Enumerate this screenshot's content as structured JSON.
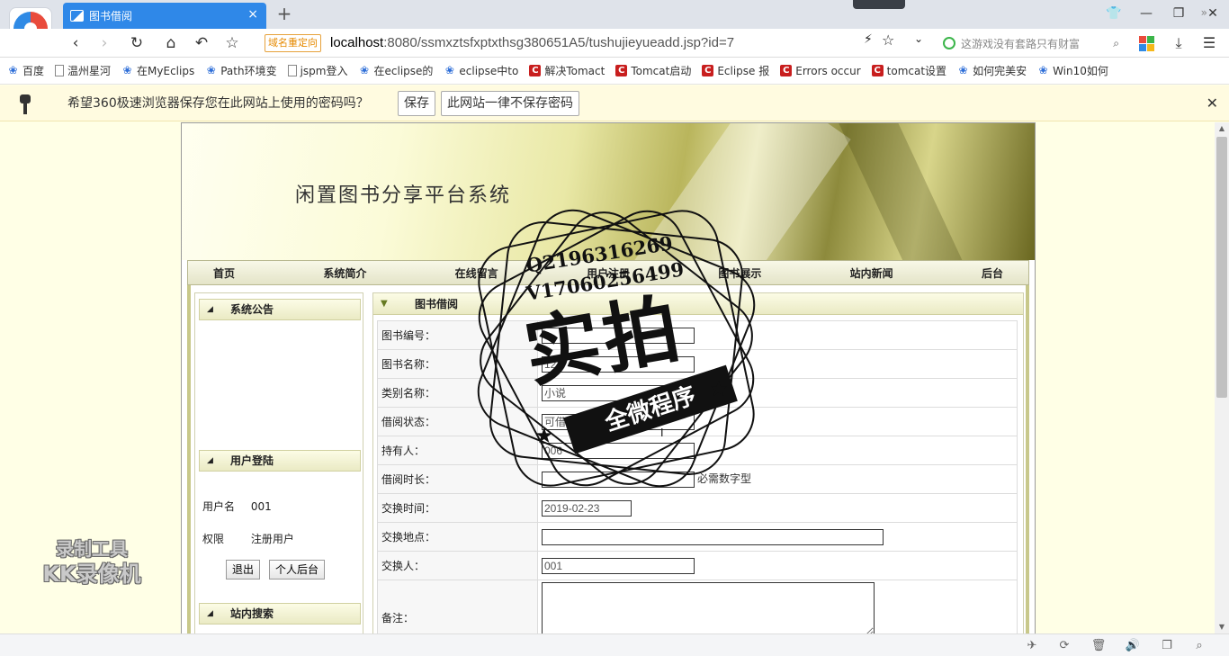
{
  "browser": {
    "tab_title": "图书借阅",
    "tab_close": "×",
    "new_tab": "+",
    "redirect_badge": "域名重定向",
    "url_host": "localhost",
    "url_rest": ":8080/ssmxztsfxptxthsg380651A5/tushujieyueadd.jsp?id=7",
    "search_placeholder": "这游戏没有套路只有财富",
    "bookmarks": [
      {
        "label": "百度",
        "icon": "paw-icon"
      },
      {
        "label": "温州星河",
        "icon": "doc-icon"
      },
      {
        "label": "在MyEclips",
        "icon": "paw-icon"
      },
      {
        "label": "Path环境变",
        "icon": "paw-icon"
      },
      {
        "label": "jspm登入",
        "icon": "doc-icon"
      },
      {
        "label": "在eclipse的",
        "icon": "paw-icon"
      },
      {
        "label": "eclipse中to",
        "icon": "paw-icon"
      },
      {
        "label": "解决Tomact",
        "icon": "csdn-icon"
      },
      {
        "label": "Tomcat启动",
        "icon": "csdn-icon"
      },
      {
        "label": "Eclipse 报",
        "icon": "csdn-icon"
      },
      {
        "label": "Errors occur",
        "icon": "csdn-icon"
      },
      {
        "label": "tomcat设置",
        "icon": "csdn-icon"
      },
      {
        "label": "如何完美安",
        "icon": "paw-icon"
      },
      {
        "label": "Win10如何",
        "icon": "paw-icon"
      }
    ],
    "bookmarks_more": "»",
    "password_bar": {
      "message": "希望360极速浏览器保存您在此网站上使用的密码吗？",
      "save": "保存",
      "never": "此网站一律不保存密码",
      "close": "✕"
    }
  },
  "site": {
    "title": "闲置图书分享平台系统",
    "nav": [
      "首页",
      "系统简介",
      "在线留言",
      "用户注册",
      "图书展示",
      "站内新闻",
      "后台"
    ]
  },
  "sidebar": {
    "notice_title": "系统公告",
    "login_title": "用户登陆",
    "username_label": "用户名",
    "username_value": "001",
    "role_label": "权限",
    "role_value": "注册用户",
    "logout": "退出",
    "personal": "个人后台",
    "search_title": "站内搜索"
  },
  "form": {
    "title": "图书借阅",
    "fields": [
      {
        "label": "图书编号：",
        "value": ""
      },
      {
        "label": "图书名称：",
        "value": "123"
      },
      {
        "label": "类别名称：",
        "value": "小说"
      },
      {
        "label": "借阅状态：",
        "value": "可借阅"
      },
      {
        "label": "持有人：",
        "value": "006"
      },
      {
        "label": "借阅时长：",
        "value": "",
        "hint": "必需数字型"
      },
      {
        "label": "交换时间：",
        "value": "2019-02-23"
      },
      {
        "label": "交换地点：",
        "value": ""
      },
      {
        "label": "交换人：",
        "value": "001"
      },
      {
        "label": "备注：",
        "value": ""
      }
    ]
  },
  "stamp": {
    "qq": "Q2196316269",
    "vx": "V17060256499",
    "big": "实拍",
    "ribbon": "全微程序"
  },
  "recorder": {
    "line1": "录制工具",
    "line2": "KK录像机"
  },
  "colors": {
    "tab_active": "#2f88e8",
    "page_bg": "#ffffe6",
    "banner_olive": "#b9b55c"
  }
}
